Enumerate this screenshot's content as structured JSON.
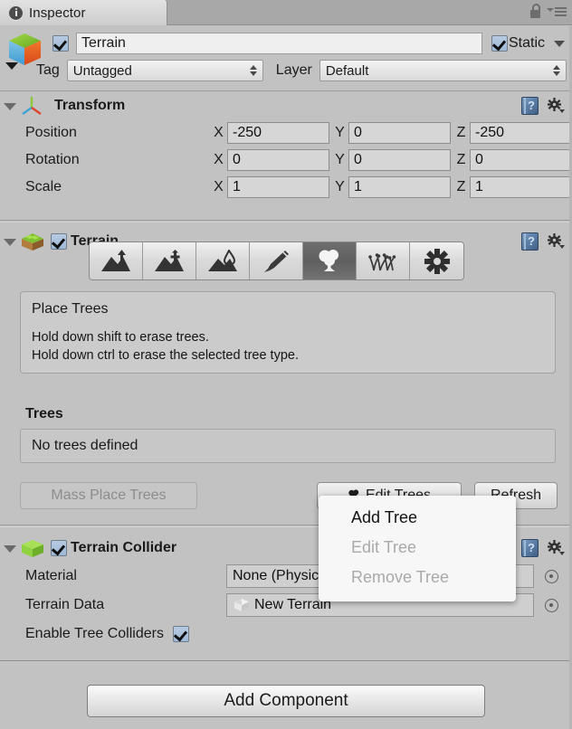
{
  "window": {
    "tab_label": "Inspector",
    "tab_icon": "info-icon",
    "lock_icon": "lock-icon",
    "menu_icon": "hamburger-menu-icon"
  },
  "gameobject": {
    "icon": "gameobject-cube-icon",
    "enabled": true,
    "name": "Terrain",
    "static_label": "Static",
    "static_checked": true,
    "tag_label": "Tag",
    "tag_value": "Untagged",
    "layer_label": "Layer",
    "layer_value": "Default"
  },
  "transform": {
    "title": "Transform",
    "icon": "transform-axis-icon",
    "help_icon": "help-book-icon",
    "gear_icon": "gear-icon",
    "rows": [
      {
        "label": "Position",
        "x": "-250",
        "y": "0",
        "z": "-250"
      },
      {
        "label": "Rotation",
        "x": "0",
        "y": "0",
        "z": "0"
      },
      {
        "label": "Scale",
        "x": "1",
        "y": "1",
        "z": "1"
      }
    ],
    "axis_labels": {
      "x": "X",
      "y": "Y",
      "z": "Z"
    }
  },
  "terrain": {
    "title": "Terrain",
    "icon": "terrain-grass-icon",
    "enabled": true,
    "help_icon": "help-book-icon",
    "gear_icon": "gear-icon",
    "tools": [
      {
        "name": "raise-lower-terrain-tool",
        "selected": false
      },
      {
        "name": "paint-height-tool",
        "selected": false
      },
      {
        "name": "smooth-height-tool",
        "selected": false
      },
      {
        "name": "paint-texture-tool",
        "selected": false
      },
      {
        "name": "place-trees-tool",
        "selected": true
      },
      {
        "name": "paint-details-tool",
        "selected": false
      },
      {
        "name": "terrain-settings-tool",
        "selected": false
      }
    ],
    "helpbox": {
      "title": "Place Trees",
      "line1": "Hold down shift to erase trees.",
      "line2": "Hold down ctrl to erase the selected tree type."
    },
    "trees_section_label": "Trees",
    "trees_empty_text": "No trees defined",
    "mass_place_label": "Mass Place Trees",
    "mass_place_enabled": false,
    "edit_trees_label": "Edit Trees",
    "refresh_label": "Refresh"
  },
  "terrain_collider": {
    "title": "Terrain Collider",
    "icon": "terrain-collider-box-icon",
    "enabled": true,
    "help_icon": "help-book-icon",
    "gear_icon": "gear-icon",
    "material_label": "Material",
    "material_value": "None (Physic Material)",
    "material_value_visible": "None (Ph",
    "terrain_data_label": "Terrain Data",
    "terrain_data_value": "New Terrain",
    "terrain_data_icon": "terrain-asset-icon",
    "enable_tree_colliders_label": "Enable Tree Colliders",
    "enable_tree_colliders_checked": true,
    "picker_icon": "target-picker-icon"
  },
  "footer": {
    "add_component_label": "Add Component"
  },
  "context_menu": {
    "items": [
      {
        "label": "Add Tree",
        "disabled": false
      },
      {
        "label": "Edit Tree",
        "disabled": true
      },
      {
        "label": "Remove Tree",
        "disabled": true
      }
    ]
  },
  "colors": {
    "panel_bg": "#c2c2c2",
    "tab_bg": "#d5d5d5",
    "tabbar_bg": "#a8a8a8",
    "field_bg": "#d6d6d6",
    "name_field_bg": "#efefef",
    "checkbox_blue": "#a9c2dc",
    "selected_tool_bg": "#646464",
    "menu_bg": "#f7f7f7",
    "disabled_text": "#a9a9a9",
    "terrain_green": "#8fd13f",
    "terrain_soil": "#9a6a33"
  }
}
